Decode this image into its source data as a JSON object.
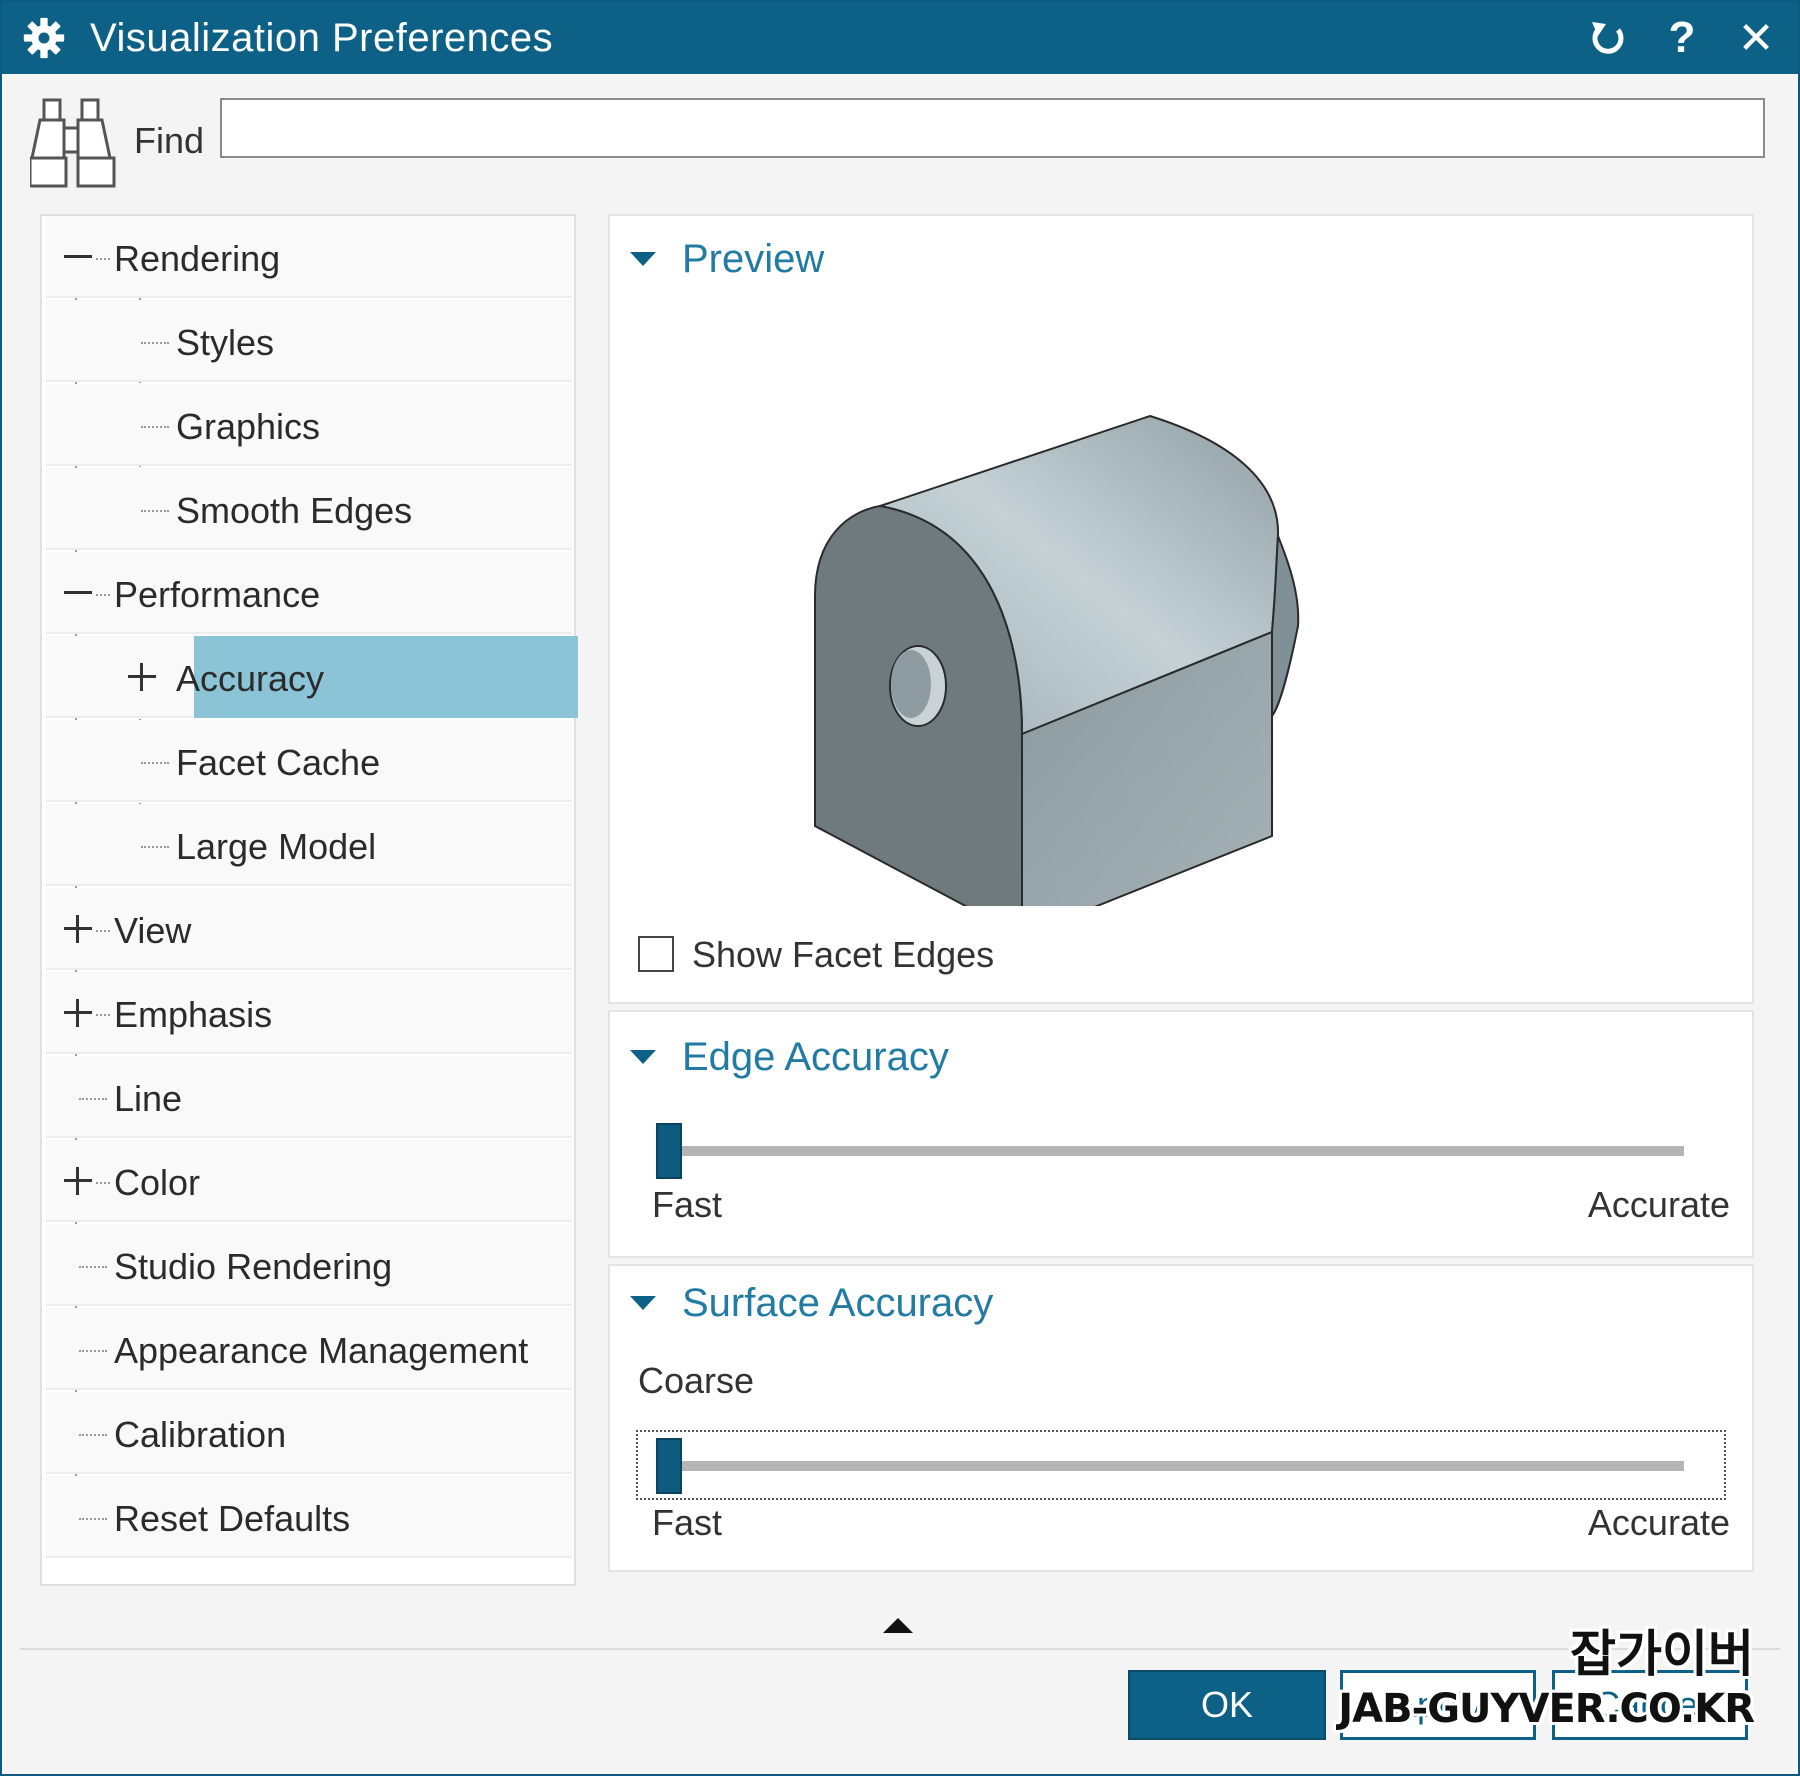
{
  "window": {
    "title": "Visualization Preferences",
    "icons": {
      "app": "gear-icon",
      "reset": "reset-icon",
      "help": "help-icon",
      "close": "close-icon"
    },
    "help_glyph": "?",
    "close_glyph": "✕"
  },
  "find": {
    "label": "Find",
    "value": "",
    "icon": "binoculars-icon"
  },
  "tree": {
    "items": [
      {
        "label": "Rendering",
        "level": 0,
        "toggle": "minus"
      },
      {
        "label": "Styles",
        "level": 1,
        "toggle": "none"
      },
      {
        "label": "Graphics",
        "level": 1,
        "toggle": "none"
      },
      {
        "label": "Smooth Edges",
        "level": 1,
        "toggle": "none"
      },
      {
        "label": "Performance",
        "level": 0,
        "toggle": "minus"
      },
      {
        "label": "Accuracy",
        "level": 1,
        "toggle": "plus",
        "selected": true
      },
      {
        "label": "Facet Cache",
        "level": 1,
        "toggle": "none"
      },
      {
        "label": "Large Model",
        "level": 1,
        "toggle": "none"
      },
      {
        "label": "View",
        "level": 0,
        "toggle": "plus"
      },
      {
        "label": "Emphasis",
        "level": 0,
        "toggle": "plus"
      },
      {
        "label": "Line",
        "level": 0,
        "toggle": "none"
      },
      {
        "label": "Color",
        "level": 0,
        "toggle": "plus"
      },
      {
        "label": "Studio Rendering",
        "level": 0,
        "toggle": "none"
      },
      {
        "label": "Appearance Management",
        "level": 0,
        "toggle": "none"
      },
      {
        "label": "Calibration",
        "level": 0,
        "toggle": "none"
      },
      {
        "label": "Reset Defaults",
        "level": 0,
        "toggle": "none"
      }
    ]
  },
  "preview": {
    "header": "Preview",
    "show_facet_edges": {
      "label": "Show Facet Edges",
      "checked": false
    }
  },
  "edge_accuracy": {
    "header": "Edge Accuracy",
    "min_label": "Fast",
    "max_label": "Accurate",
    "value": 0.0
  },
  "surface_accuracy": {
    "header": "Surface Accuracy",
    "current_label": "Coarse",
    "min_label": "Fast",
    "max_label": "Accurate",
    "value": 0.0
  },
  "buttons": {
    "ok": "OK",
    "apply": "Apply",
    "cancel": "Cancel"
  },
  "watermark": {
    "korean": "잡가이버",
    "site": "JAB-GUYVER.CO.KR"
  },
  "colors": {
    "title_bar": "#0e6186",
    "selection": "#8bc4d6",
    "section_header": "#217ba3",
    "slider_thumb": "#0e5b80"
  }
}
